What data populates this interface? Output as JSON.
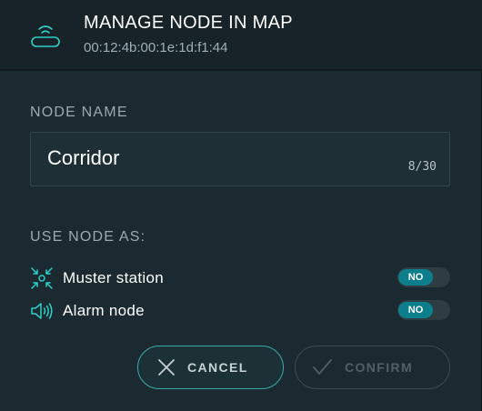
{
  "header": {
    "title": "MANAGE NODE IN MAP",
    "subtitle": "00:12:4b:00:1e:1d:f1:44",
    "icon": "wireless-node-icon"
  },
  "node_name": {
    "label": "NODE NAME",
    "value": "Corridor",
    "counter": "8/30"
  },
  "use_as": {
    "label": "USE NODE AS:",
    "options": [
      {
        "label": "Muster station",
        "icon": "muster-station-icon",
        "toggle": "NO"
      },
      {
        "label": "Alarm node",
        "icon": "speaker-icon",
        "toggle": "NO"
      }
    ]
  },
  "actions": {
    "cancel": "CANCEL",
    "confirm": "CONFIRM"
  },
  "colors": {
    "accent": "#2fd0c8",
    "toggle_on": "#0d7f8c",
    "background": "#1a2a30",
    "header": "#172328"
  }
}
